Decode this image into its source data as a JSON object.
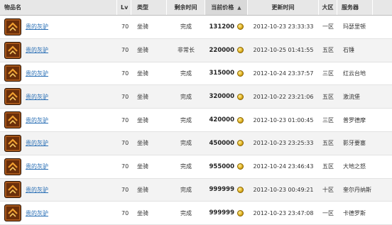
{
  "table": {
    "headers": {
      "name": "物品名",
      "level": "Lv",
      "type": "类型",
      "time_left": "剩余时间",
      "price": "当前价格",
      "updated": "更新时间",
      "zone": "大区",
      "server": "服务器"
    },
    "rows": [
      {
        "name": "贵的灰驴",
        "level": "70",
        "type": "坐骑",
        "time_left": "完成",
        "price": "131200",
        "updated": "2012-10-23 23:33:33",
        "zone": "一区",
        "server": "玛瑟里顿"
      },
      {
        "name": "贵的灰驴",
        "level": "70",
        "type": "坐骑",
        "time_left": "非常长",
        "price": "220000",
        "updated": "2012-10-25 01:41:55",
        "zone": "五区",
        "server": "石锤"
      },
      {
        "name": "贵的灰驴",
        "level": "70",
        "type": "坐骑",
        "time_left": "完成",
        "price": "315000",
        "updated": "2012-10-24 23:37:57",
        "zone": "三区",
        "server": "红云台地"
      },
      {
        "name": "贵的灰驴",
        "level": "70",
        "type": "坐骑",
        "time_left": "完成",
        "price": "320000",
        "updated": "2012-10-22 23:21:06",
        "zone": "五区",
        "server": "激流堡"
      },
      {
        "name": "贵的灰驴",
        "level": "70",
        "type": "坐骑",
        "time_left": "完成",
        "price": "420000",
        "updated": "2012-10-23 01:00:45",
        "zone": "三区",
        "server": "普罗德摩"
      },
      {
        "name": "贵的灰驴",
        "level": "70",
        "type": "坐骑",
        "time_left": "完成",
        "price": "450000",
        "updated": "2012-10-23 23:25:33",
        "zone": "五区",
        "server": "影牙要塞"
      },
      {
        "name": "贵的灰驴",
        "level": "70",
        "type": "坐骑",
        "time_left": "完成",
        "price": "955000",
        "updated": "2012-10-24 23:46:43",
        "zone": "五区",
        "server": "大地之怒"
      },
      {
        "name": "贵的灰驴",
        "level": "70",
        "type": "坐骑",
        "time_left": "完成",
        "price": "999999",
        "updated": "2012-10-23 00:49:21",
        "zone": "十区",
        "server": "奎尔丹纳斯"
      },
      {
        "name": "贵的灰驴",
        "level": "70",
        "type": "坐骑",
        "time_left": "完成",
        "price": "999999",
        "updated": "2012-10-23 23:47:08",
        "zone": "一区",
        "server": "卡德罗斯"
      }
    ]
  },
  "icons": {
    "sort": "sort-up-icon",
    "currency": "gold-coin-icon",
    "item": "mount-item-icon"
  },
  "colors": {
    "header_bg": "#e7e7e7",
    "alt_row_bg": "#f3f3f3",
    "link": "#2a6fb5",
    "gold": "#e0b020"
  }
}
